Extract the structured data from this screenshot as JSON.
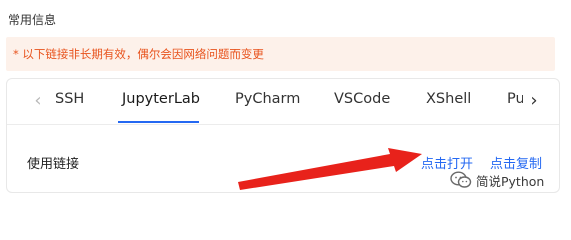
{
  "section": {
    "title": "常用信息"
  },
  "notice": {
    "text": "* 以下链接非长期有效，偶尔会因网络问题而变更"
  },
  "tabs": {
    "items": [
      {
        "label": "SSH"
      },
      {
        "label": "JupyterLab"
      },
      {
        "label": "PyCharm"
      },
      {
        "label": "VSCode"
      },
      {
        "label": "XShell"
      },
      {
        "label": "Pu"
      }
    ],
    "active_index": 1,
    "prev_icon": "chevron-left-icon",
    "next_icon": "chevron-right-icon",
    "prev_glyph": "‹",
    "next_glyph": "›"
  },
  "link_row": {
    "label": "使用链接",
    "open_label": "点击打开",
    "copy_label": "点击复制"
  },
  "annotation": {
    "arrow_color": "#e8221b"
  },
  "watermark": {
    "text": "简说Python",
    "icon": "wechat-logo-icon"
  },
  "colors": {
    "accent": "#2468f2",
    "notice_text": "#e8531d",
    "notice_bg": "#fdf1ea"
  }
}
